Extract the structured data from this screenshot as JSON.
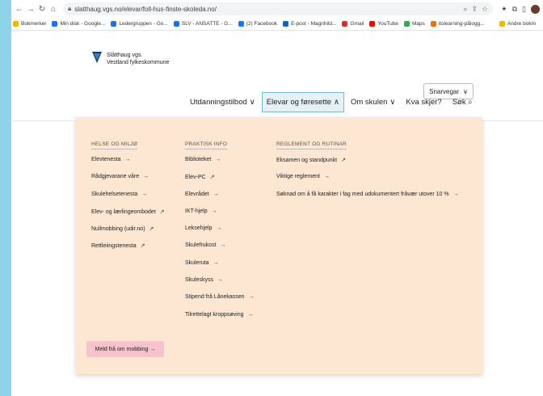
{
  "browser": {
    "url": "slatthaug.vgs.no/elevar/foll-hus-finste-skoleda.no/",
    "bookmarks": [
      {
        "label": "Bokmerker",
        "color": "#f4b400"
      },
      {
        "label": "Min disk - Google...",
        "color": "#1a73e8"
      },
      {
        "label": "Ledergruppen - Go...",
        "color": "#1a73e8"
      },
      {
        "label": "SLV - ANSATTE - G...",
        "color": "#1a73e8"
      },
      {
        "label": "(2) Facebook",
        "color": "#1877f2"
      },
      {
        "label": "E-post - Magnhild...",
        "color": "#0a66c2"
      },
      {
        "label": "Gmail",
        "color": "#d93025"
      },
      {
        "label": "YouTube",
        "color": "#ff0000"
      },
      {
        "label": "Maps",
        "color": "#34a853"
      },
      {
        "label": "itslearning-pålogg...",
        "color": "#e8710a"
      }
    ],
    "other_bookmarks": "Andre bokm"
  },
  "site": {
    "school_name": "Slåtthaug vgs.",
    "county": "Vestland fylkeskommune",
    "shortcut_label": "Snarvegar",
    "nav": [
      {
        "label": "Utdanningstilbod",
        "chev": "∨",
        "active": false
      },
      {
        "label": "Elevar og føresette",
        "chev": "∧",
        "active": true
      },
      {
        "label": "Om skulen",
        "chev": "∨",
        "active": false
      },
      {
        "label": "Kva skjer?",
        "chev": "",
        "active": false
      },
      {
        "label": "Søk",
        "chev": "",
        "active": false
      }
    ]
  },
  "dropdown": {
    "columns": [
      {
        "heading": "HELSE OG MILJØ",
        "links": [
          {
            "label": "Elevtenesta",
            "arrow": "→"
          },
          {
            "label": "Rådgjevarane våre",
            "arrow": "→"
          },
          {
            "label": "Skulehelsetenesta",
            "arrow": "→"
          },
          {
            "label": "Elev- og lærlingeombodet",
            "arrow": "↗"
          },
          {
            "label": "Nullmobbing (udir.no)",
            "arrow": "↗"
          },
          {
            "label": "Rettleiingstenesta",
            "arrow": "↗"
          }
        ]
      },
      {
        "heading": "PRAKTISK INFO",
        "links": [
          {
            "label": "Biblioteket",
            "arrow": "→"
          },
          {
            "label": "Elev-PC",
            "arrow": "↗"
          },
          {
            "label": "Elevrådet",
            "arrow": "→"
          },
          {
            "label": "IKT-hjelp",
            "arrow": "→"
          },
          {
            "label": "Leksehjelp",
            "arrow": "→"
          },
          {
            "label": "Skulefrukost",
            "arrow": "→"
          },
          {
            "label": "Skuleruta",
            "arrow": "→"
          },
          {
            "label": "Skuleskyss",
            "arrow": "→"
          },
          {
            "label": "Stipend frå Lånekassen",
            "arrow": "→"
          },
          {
            "label": "Tilrettelagt kroppsøving",
            "arrow": "→"
          }
        ]
      },
      {
        "heading": "REGLEMENT OG RUTINAR",
        "links": [
          {
            "label": "Eksamen og standpunkt",
            "arrow": "↗"
          },
          {
            "label": "Viktige reglement",
            "arrow": "→"
          },
          {
            "label": "Søknad om å få karakter i fag med udokumentert fråvær utover 10 %",
            "arrow": "→"
          }
        ]
      }
    ],
    "report_bullying": "Meld frå om mobbing →"
  }
}
